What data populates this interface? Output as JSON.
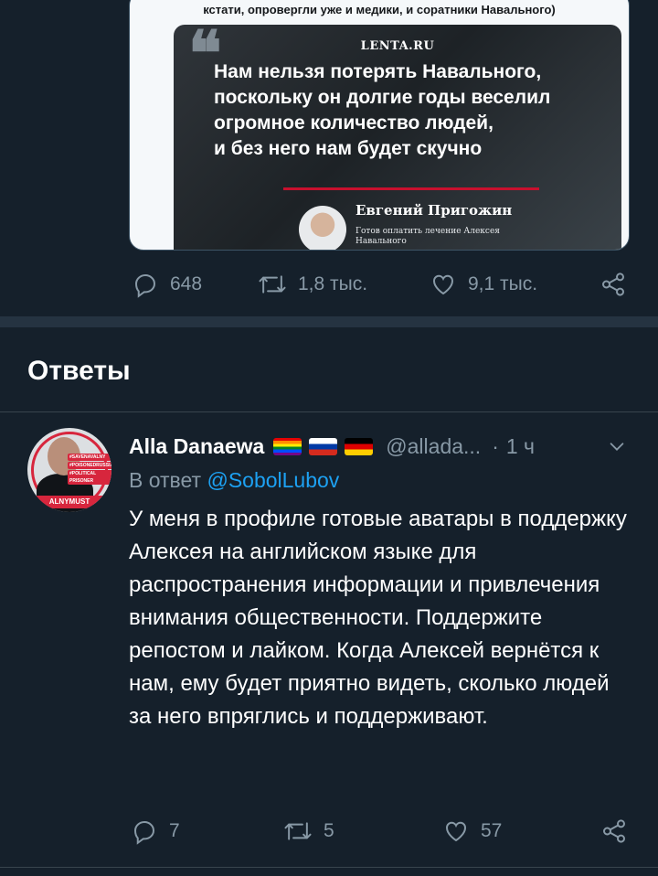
{
  "quoted_card": {
    "caption": "кстати, опровергли уже и медики, и соратники Навального)",
    "source": "LENTA.RU",
    "quote_lines": [
      "Нам нельзя потерять Навального,",
      "поскольку он долгие годы веселил",
      "огромное количество людей,",
      "и без него нам будет скучно"
    ],
    "author_name": "Евгений Пригожин",
    "author_caption": "Готов оплатить лечение Алексея Навального"
  },
  "original_actions": {
    "replies": "648",
    "retweets": "1,8 тыс.",
    "likes": "9,1 тыс."
  },
  "section_title": "Ответы",
  "reply": {
    "avatar_band": "ALNYMUST",
    "avatar_tags": [
      "#SAVENAVALNY",
      "#POISONEDRUSSIA",
      "#POLITICAL PRISONER"
    ],
    "display_name": "Alla Danaewa",
    "handle": "@allada...",
    "separator": "·",
    "time": "1 ч",
    "reply_prefix": "В ответ",
    "reply_mention": "@SobolLubov",
    "text": "У меня в профиле готовые аватары в поддержку Алексея на английском языке для распространения информации и привлечения внимания общественности. Поддержите репостом и лайком. Когда Алексей вернётся к нам, ему будет приятно видеть, сколько людей за него впряглись и поддерживают.",
    "actions": {
      "replies": "7",
      "retweets": "5",
      "likes": "57"
    }
  },
  "icons": {
    "reply": "reply-icon",
    "retweet": "retweet-icon",
    "like": "heart-icon",
    "share": "share-icon",
    "caret": "chevron-down-icon"
  },
  "colors": {
    "background": "#15202b",
    "muted": "#8899a6",
    "accent": "#1da1f2",
    "separator": "#253341"
  }
}
